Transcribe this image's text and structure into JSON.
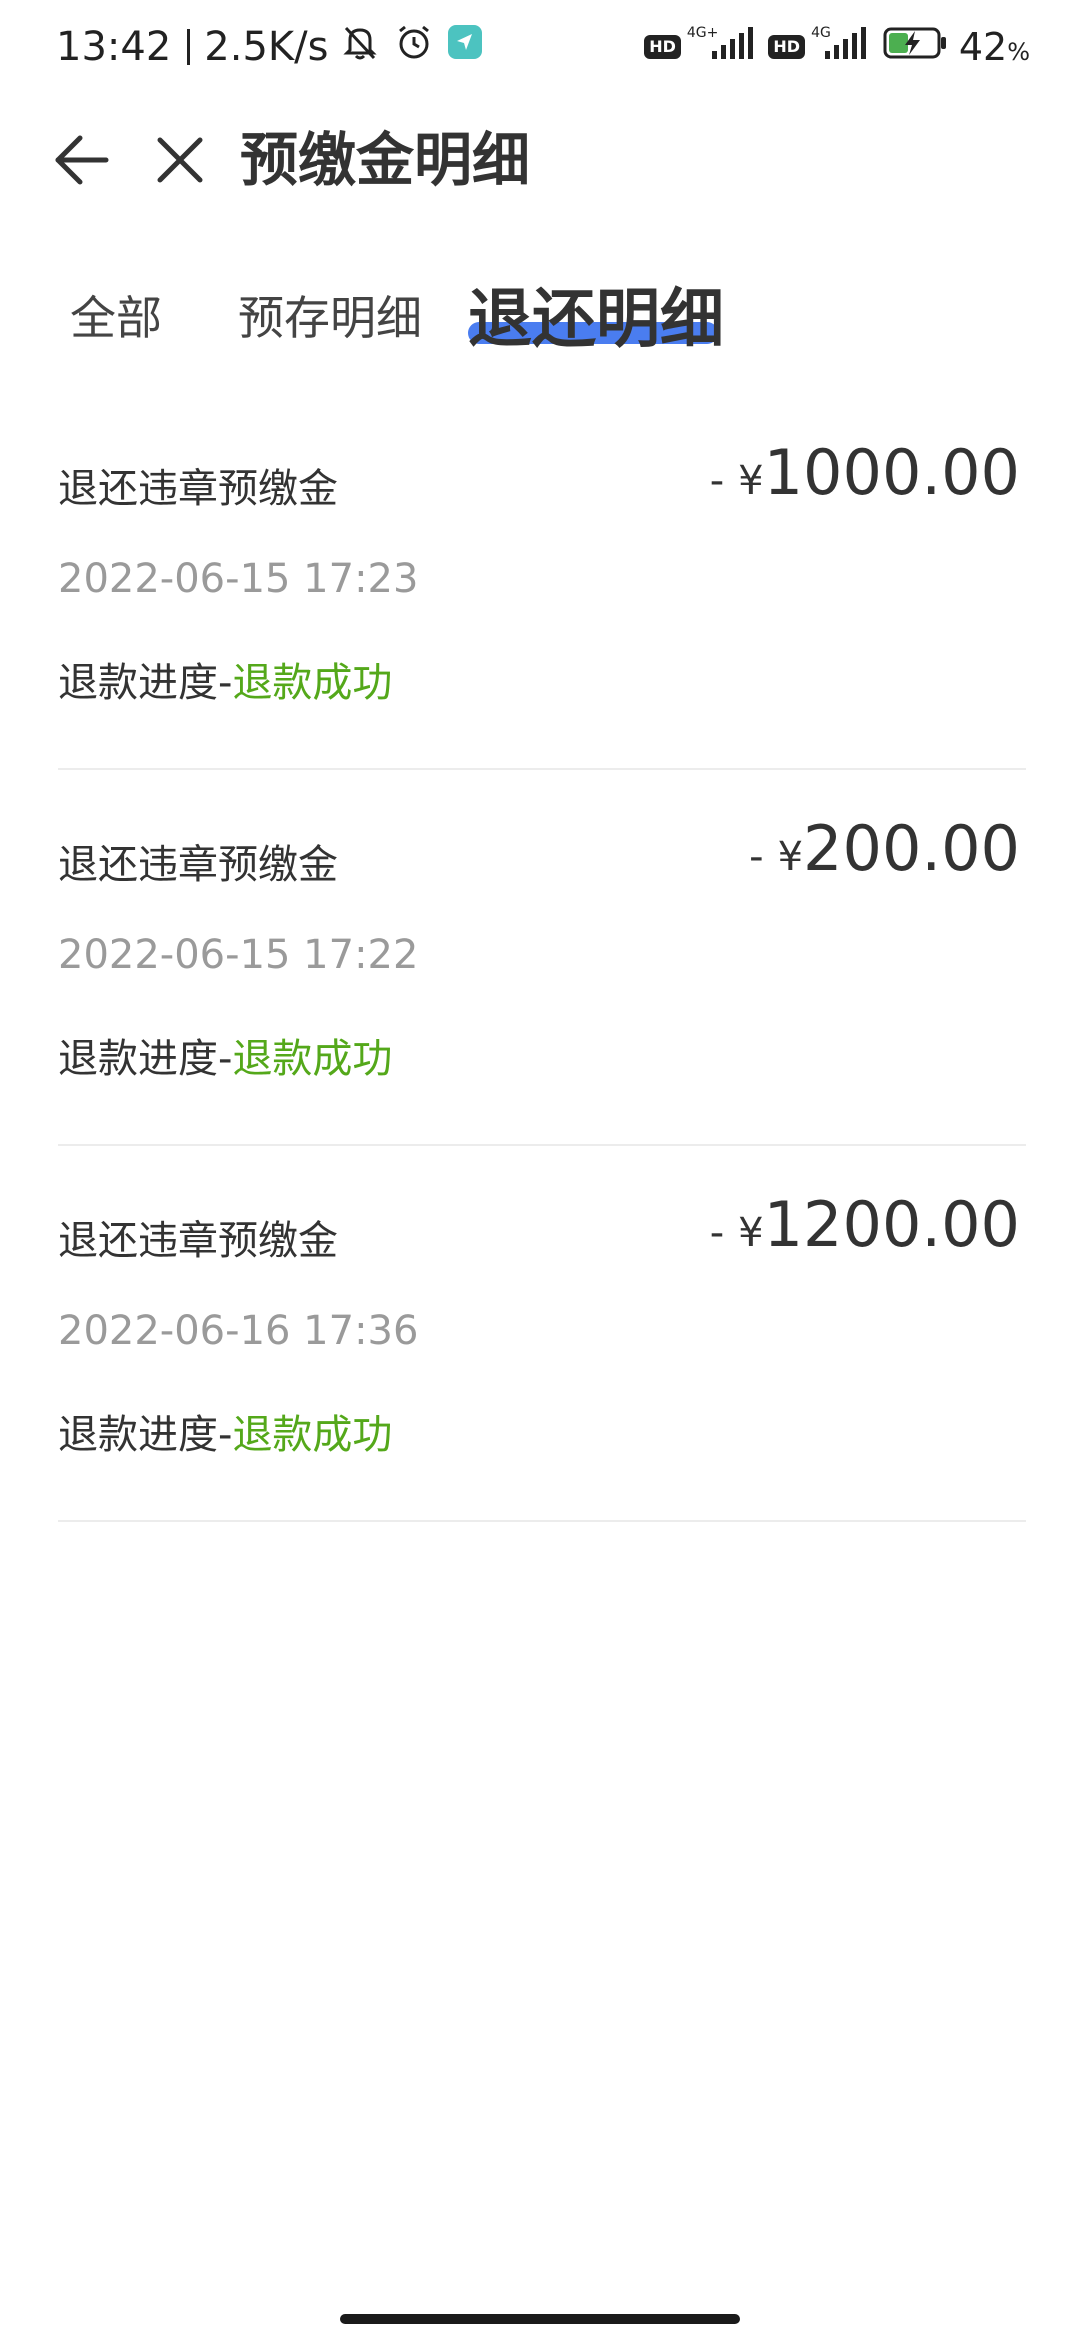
{
  "status_bar": {
    "time": "13:42",
    "net_speed": "2.5K/s",
    "hd_label": "HD",
    "network_1": "4G+",
    "network_2": "4G",
    "battery_value": "42",
    "battery_unit": "%",
    "battery_level_percent": 42,
    "app_notif_color": "#4cc3c0",
    "battery_charge_color": "#4caf50"
  },
  "header": {
    "title": "预缴金明细",
    "back_icon": "back-arrow-icon",
    "close_icon": "close-icon"
  },
  "tabs": [
    {
      "label": "全部",
      "active": false
    },
    {
      "label": "预存明细",
      "active": false
    },
    {
      "label": "退还明细",
      "active": true
    }
  ],
  "tab_active_color": "#4a7df0",
  "records": [
    {
      "title": "退还违章预缴金",
      "amount_sign": "-",
      "currency": "¥",
      "amount": "1000.00",
      "time": "2022-06-15 17:23",
      "progress_label": "退款进度-",
      "status": "退款成功"
    },
    {
      "title": "退还违章预缴金",
      "amount_sign": "-",
      "currency": "¥",
      "amount": "200.00",
      "time": "2022-06-15 17:22",
      "progress_label": "退款进度-",
      "status": "退款成功"
    },
    {
      "title": "退还违章预缴金",
      "amount_sign": "-",
      "currency": "¥",
      "amount": "1200.00",
      "time": "2022-06-16 17:36",
      "progress_label": "退款进度-",
      "status": "退款成功"
    }
  ],
  "status_success_color": "#54a81a"
}
